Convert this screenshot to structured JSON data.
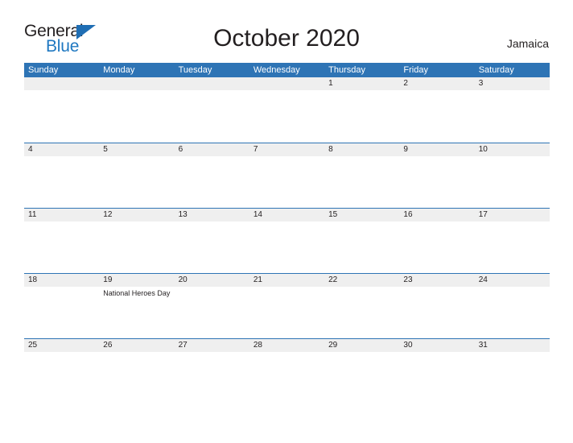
{
  "branding": {
    "logo_text_primary": "General",
    "logo_text_secondary": "Blue",
    "accent_color": "#1f6eb4"
  },
  "header": {
    "title": "October 2020",
    "country": "Jamaica"
  },
  "calendar": {
    "header_bg_color": "#2e74b5",
    "band_bg_color": "#efefef",
    "weekdays": [
      "Sunday",
      "Monday",
      "Tuesday",
      "Wednesday",
      "Thursday",
      "Friday",
      "Saturday"
    ],
    "weeks": [
      [
        {
          "day": "",
          "events": []
        },
        {
          "day": "",
          "events": []
        },
        {
          "day": "",
          "events": []
        },
        {
          "day": "",
          "events": []
        },
        {
          "day": "1",
          "events": []
        },
        {
          "day": "2",
          "events": []
        },
        {
          "day": "3",
          "events": []
        }
      ],
      [
        {
          "day": "4",
          "events": []
        },
        {
          "day": "5",
          "events": []
        },
        {
          "day": "6",
          "events": []
        },
        {
          "day": "7",
          "events": []
        },
        {
          "day": "8",
          "events": []
        },
        {
          "day": "9",
          "events": []
        },
        {
          "day": "10",
          "events": []
        }
      ],
      [
        {
          "day": "11",
          "events": []
        },
        {
          "day": "12",
          "events": []
        },
        {
          "day": "13",
          "events": []
        },
        {
          "day": "14",
          "events": []
        },
        {
          "day": "15",
          "events": []
        },
        {
          "day": "16",
          "events": []
        },
        {
          "day": "17",
          "events": []
        }
      ],
      [
        {
          "day": "18",
          "events": []
        },
        {
          "day": "19",
          "events": [
            "National Heroes Day"
          ]
        },
        {
          "day": "20",
          "events": []
        },
        {
          "day": "21",
          "events": []
        },
        {
          "day": "22",
          "events": []
        },
        {
          "day": "23",
          "events": []
        },
        {
          "day": "24",
          "events": []
        }
      ],
      [
        {
          "day": "25",
          "events": []
        },
        {
          "day": "26",
          "events": []
        },
        {
          "day": "27",
          "events": []
        },
        {
          "day": "28",
          "events": []
        },
        {
          "day": "29",
          "events": []
        },
        {
          "day": "30",
          "events": []
        },
        {
          "day": "31",
          "events": []
        }
      ]
    ]
  }
}
